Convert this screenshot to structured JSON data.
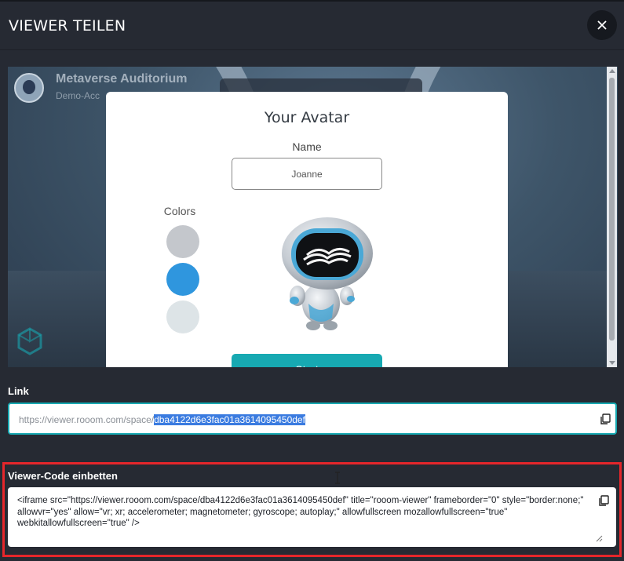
{
  "modal": {
    "title": "VIEWER TEILEN",
    "close_icon": "close-icon"
  },
  "preview": {
    "space_title": "Metaverse Auditorium",
    "space_subtitle": "Demo-Acc"
  },
  "avatar_dialog": {
    "title": "Your Avatar",
    "name_label": "Name",
    "name_value": "Joanne",
    "colors_label": "Colors",
    "colors": [
      "#c4c7cc",
      "#2f96de",
      "#dde4e7"
    ],
    "start_button": "Start"
  },
  "link": {
    "label": "Link",
    "url_prefix": "https://viewer.rooom.com/space/",
    "url_selected": "dba4122d6e3fac01a3614095450def",
    "copy_icon": "copy-icon"
  },
  "embed": {
    "label": "Viewer-Code einbetten",
    "code": "<iframe src=\"https://viewer.rooom.com/space/dba4122d6e3fac01a3614095450def\" title=\"rooom-viewer\" frameborder=\"0\" style=\"border:none;\" allowvr=\"yes\" allow=\"vr; xr; accelerometer; magnetometer; gyroscope; autoplay;\" allowfullscreen mozallowfullscreen=\"true\" webkitallowfullscreen=\"true\" />",
    "copy_icon": "copy-icon"
  },
  "colors": {
    "accent": "#17a9b2",
    "highlight": "#e5262b",
    "modal_bg": "#262a33"
  }
}
